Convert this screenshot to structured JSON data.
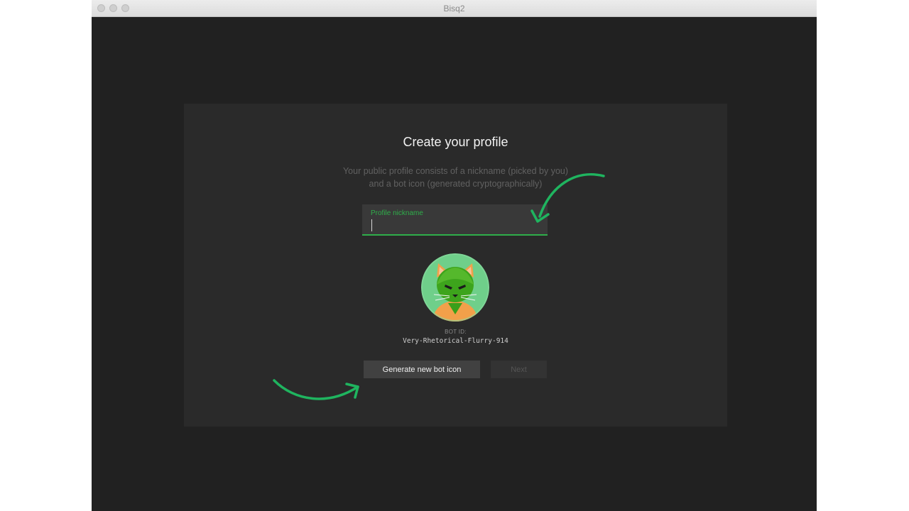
{
  "window": {
    "title": "Bisq2"
  },
  "profile": {
    "heading": "Create your profile",
    "subtitle_line1": "Your public profile consists of a nickname (picked by you)",
    "subtitle_line2": "and a bot icon (generated cryptographically)",
    "nickname_label": "Profile nickname",
    "nickname_value": "",
    "bot_id_label": "BOT ID:",
    "bot_id": "Very-Rhetorical-Flurry-914",
    "generate_button": "Generate new bot icon",
    "next_button": "Next"
  },
  "colors": {
    "accent": "#2fae4a",
    "window_bg": "#212121",
    "panel_bg": "#2a2a2a",
    "annotation_arrow": "#1fb45f"
  },
  "icons": {
    "avatar": "bot-cat-icon",
    "annotation": "curved-arrow-icon"
  }
}
